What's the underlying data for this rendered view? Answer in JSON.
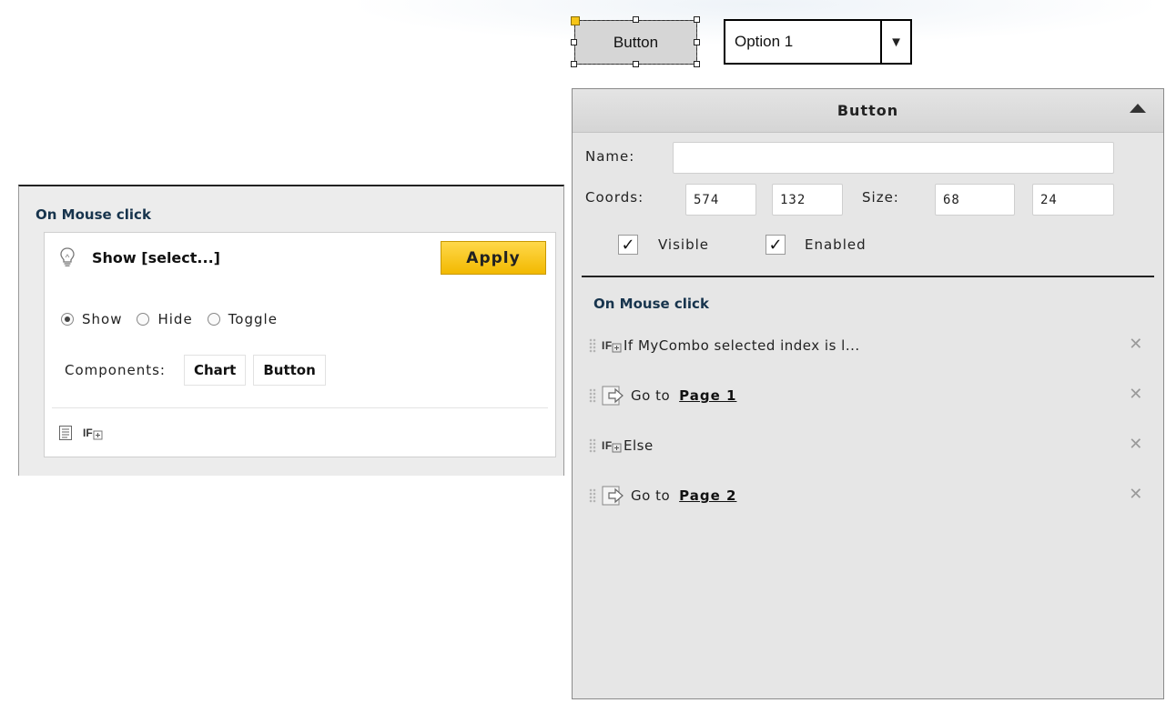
{
  "canvas": {
    "button_label": "Button",
    "combo_value": "Option 1",
    "combo_arrow": "▼"
  },
  "left_panel": {
    "title": "On Mouse click",
    "show_title": "Show [select...]",
    "apply_label": "Apply",
    "radio_options": [
      {
        "label": "Show",
        "selected": true
      },
      {
        "label": "Hide",
        "selected": false
      },
      {
        "label": "Toggle",
        "selected": false
      }
    ],
    "components_label": "Components:",
    "components": [
      "Chart",
      "Button"
    ],
    "icons": [
      "lightbulb-icon",
      "list-icon",
      "if-plus-icon"
    ]
  },
  "right_panel": {
    "header_title": "Button",
    "name_label": "Name:",
    "name_value": "",
    "coords_label": "Coords:",
    "coord_x": "574",
    "coord_y": "132",
    "size_label": "Size:",
    "size_w": "68",
    "size_h": "24",
    "visible_label": "Visible",
    "visible_checked": true,
    "enabled_label": "Enabled",
    "enabled_checked": true,
    "check_mark": "✓",
    "section_title": "On Mouse click",
    "remove_glyph": "✕",
    "actions": [
      {
        "type": "if",
        "text": "If MyCombo selected index is l...",
        "link": ""
      },
      {
        "type": "goto",
        "text": "Go to",
        "link": "Page 1"
      },
      {
        "type": "if",
        "text": "Else",
        "link": ""
      },
      {
        "type": "goto",
        "text": "Go to",
        "link": "Page 2"
      }
    ]
  },
  "colors": {
    "apply_accent": "#f2b900",
    "section_title": "#17344d",
    "panel_bg": "#e6e6e6"
  }
}
